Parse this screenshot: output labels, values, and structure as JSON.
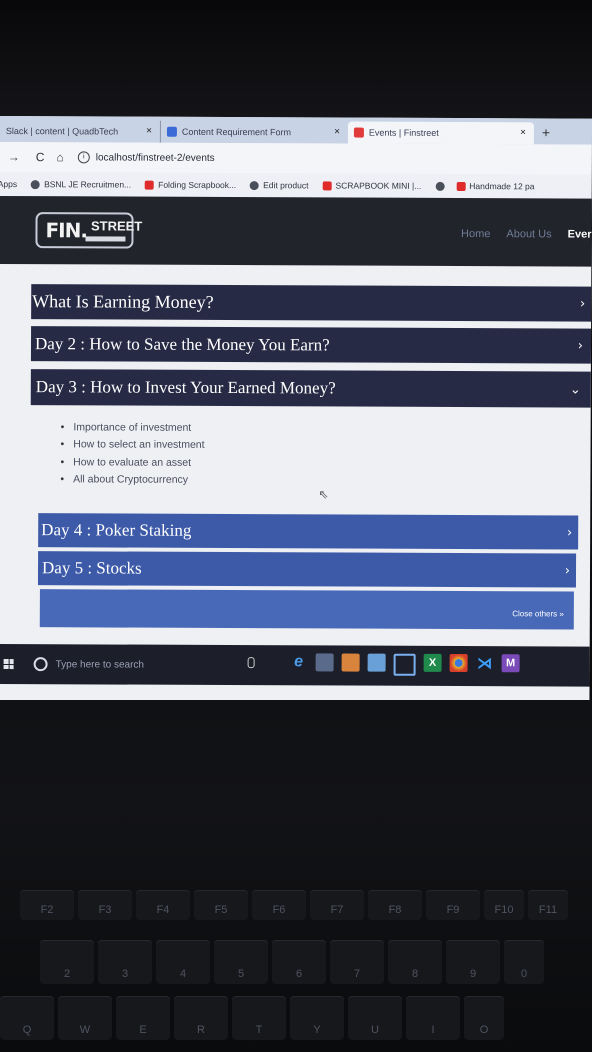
{
  "browser": {
    "tabs": [
      {
        "title": "Slack | content | QuadbTech",
        "favicon": "slack-icon",
        "close": "×"
      },
      {
        "title": "Content Requirement Form",
        "favicon": "form-icon",
        "close": "×"
      },
      {
        "title": "Events | Finstreet",
        "favicon": "events-icon",
        "close": "×",
        "active": true
      }
    ],
    "new_tab": "+",
    "back": "→",
    "reload": "C",
    "home": "⌂",
    "url": "localhost/finstreet-2/events",
    "bookmarks": [
      {
        "label": "Apps",
        "icon": "apps-icon"
      },
      {
        "label": "BSNL JE Recruitmen...",
        "icon": "globe-icon"
      },
      {
        "label": "Folding Scrapbook...",
        "icon": "youtube-icon"
      },
      {
        "label": "Edit product",
        "icon": "globe-icon"
      },
      {
        "label": "SCRAPBOOK MINI |...",
        "icon": "youtube-icon"
      },
      {
        "label": "",
        "icon": "globe-icon"
      },
      {
        "label": "Handmade 12 pa",
        "icon": "youtube-icon"
      }
    ]
  },
  "site": {
    "logo_fin": "FIN.",
    "logo_street": "STREET",
    "nav": [
      {
        "label": "Home"
      },
      {
        "label": "About Us"
      },
      {
        "label": "Ever"
      }
    ]
  },
  "accordion": [
    {
      "title": "What Is Earning Money?",
      "chevron": "›"
    },
    {
      "title": "Day 2 : How to Save the Money You Earn?",
      "chevron": "›"
    },
    {
      "title": "Day 3 : How to Invest Your Earned Money?",
      "chevron": "⌄",
      "expanded": true,
      "items": [
        "Importance of investment",
        "How to select an investment",
        "How to evaluate an asset",
        "All about Cryptocurrency"
      ]
    },
    {
      "title": "Day 4 : Poker Staking",
      "chevron": "›"
    },
    {
      "title": "Day 5 : Stocks",
      "chevron": "›"
    }
  ],
  "close_others": "Close others »",
  "taskbar": {
    "search_placeholder": "Type here to search"
  },
  "keyboard": {
    "function_row": [
      "F2",
      "F3",
      "F4",
      "F5",
      "F6",
      "F7",
      "F8",
      "F9",
      "F10",
      "F11"
    ],
    "number_row": [
      "2",
      "3",
      "4",
      "5",
      "6",
      "7",
      "8",
      "9",
      "0"
    ],
    "letter_row": [
      "Q",
      "W",
      "E",
      "R",
      "T",
      "Y",
      "U",
      "I",
      "O"
    ]
  },
  "colors": {
    "header_bg": "#22242c",
    "accordion_dark": "#272a45",
    "accordion_blue": "#3d5aa8",
    "page_bg": "#eef0f4"
  }
}
